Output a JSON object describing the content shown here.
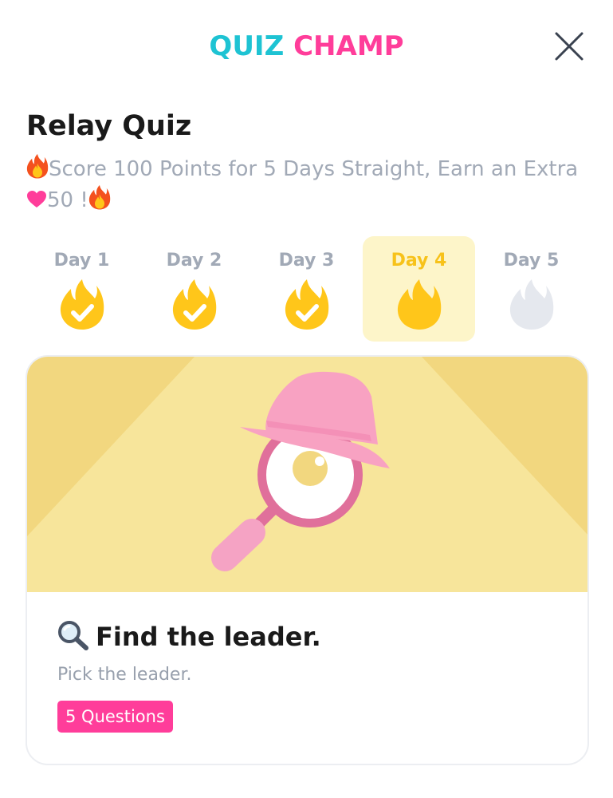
{
  "header": {
    "logo_word1": "QUIZ",
    "logo_word2": "CHAMP",
    "close_icon": "close-icon"
  },
  "quiz": {
    "title": "Relay Quiz",
    "subtitle_part1": "Score 100 Points for 5 Days Straight, Earn an Extra",
    "subtitle_part2": "50 !",
    "subtitle_icons": [
      "flame-icon",
      "heart-icon",
      "flame-icon"
    ]
  },
  "days": [
    {
      "label": "Day 1",
      "status": "completed",
      "icon": "flame-check-icon"
    },
    {
      "label": "Day 2",
      "status": "completed",
      "icon": "flame-check-icon"
    },
    {
      "label": "Day 3",
      "status": "completed",
      "icon": "flame-check-icon"
    },
    {
      "label": "Day 4",
      "status": "current",
      "icon": "flame-icon"
    },
    {
      "label": "Day 5",
      "status": "locked",
      "icon": "flame-grey-icon"
    }
  ],
  "challenge": {
    "icon": "magnifier-icon",
    "title": "Find the leader.",
    "description": "Pick the leader.",
    "badge": "5 Questions",
    "illustration": "detective-magnifier-illustration"
  },
  "colors": {
    "logo_cyan": "#1ec3d3",
    "logo_pink": "#ff3d9a",
    "flame_yellow": "#ffc61a",
    "active_day_bg": "#fdf5c9",
    "banner_yellow": "#f7e59b",
    "badge_pink": "#ff3d9a"
  }
}
